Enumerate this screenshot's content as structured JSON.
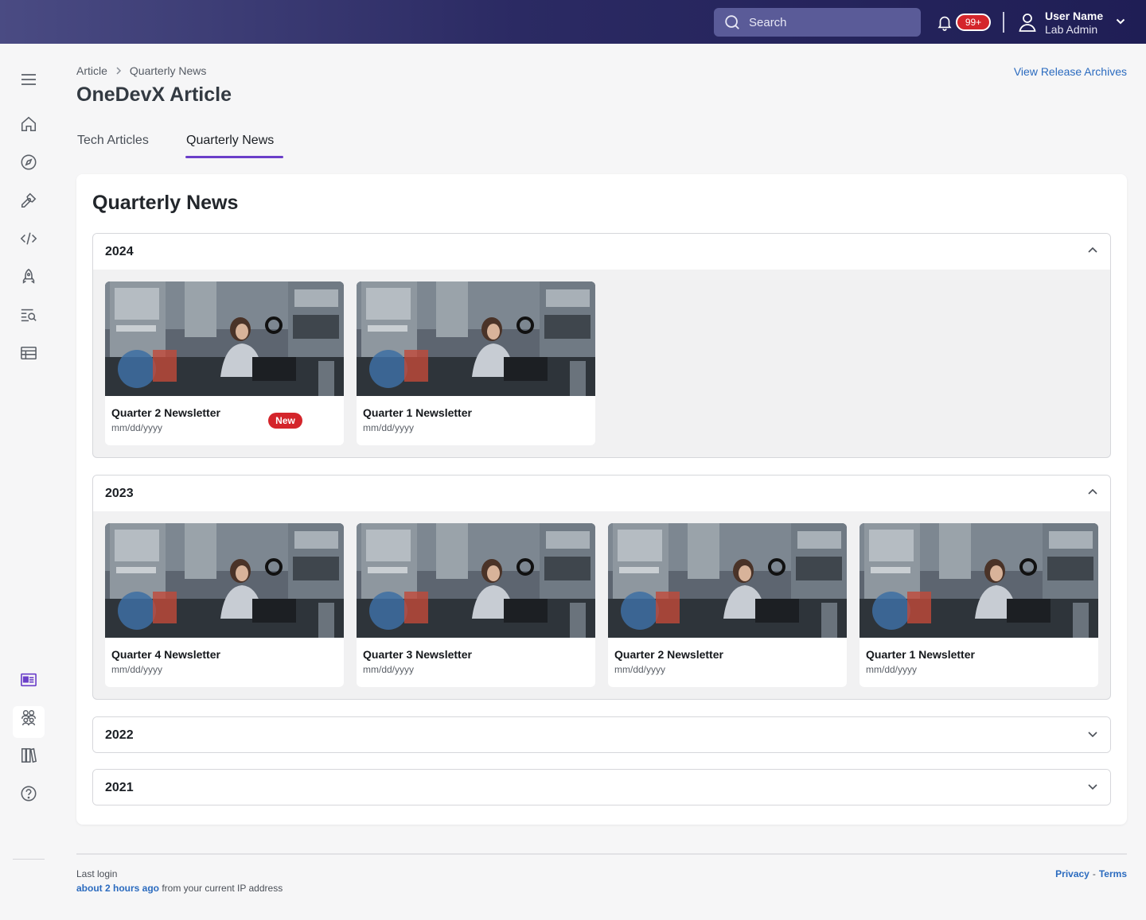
{
  "header": {
    "search_placeholder": "Search",
    "notification_count": "99+",
    "user_name": "User Name",
    "user_role": "Lab Admin"
  },
  "sidebar": {
    "icons": [
      "menu-icon",
      "home-icon",
      "compass-icon",
      "pen-icon",
      "code-icon",
      "rocket-icon",
      "search-list-icon",
      "table-icon",
      "newspaper-icon",
      "team-icon",
      "library-icon",
      "help-icon"
    ],
    "active": "newspaper-icon"
  },
  "breadcrumb": {
    "items": [
      "Article",
      "Quarterly News"
    ]
  },
  "page": {
    "title": "OneDevX Article",
    "archives_link": "View Release Archives",
    "tabs": [
      {
        "label": "Tech Articles"
      },
      {
        "label": "Quarterly News"
      }
    ],
    "active_tab": "Quarterly News"
  },
  "section": {
    "title": "Quarterly News",
    "years": [
      {
        "year": "2024",
        "expanded": true,
        "items": [
          {
            "title": "Quarter 2 Newsletter",
            "date": "mm/dd/yyyy",
            "badge": "New"
          },
          {
            "title": "Quarter 1 Newsletter",
            "date": "mm/dd/yyyy"
          }
        ]
      },
      {
        "year": "2023",
        "expanded": true,
        "items": [
          {
            "title": "Quarter 4 Newsletter",
            "date": "mm/dd/yyyy"
          },
          {
            "title": "Quarter 3 Newsletter",
            "date": "mm/dd/yyyy"
          },
          {
            "title": "Quarter 2 Newsletter",
            "date": "mm/dd/yyyy"
          },
          {
            "title": "Quarter 1 Newsletter",
            "date": "mm/dd/yyyy"
          }
        ]
      },
      {
        "year": "2022",
        "expanded": false
      },
      {
        "year": "2021",
        "expanded": false
      }
    ]
  },
  "footer": {
    "last_login_label": "Last login",
    "login_time": "about 2 hours ago",
    "login_suffix": " from your current IP address",
    "privacy": "Privacy",
    "separator": "-",
    "terms": "Terms"
  },
  "colors": {
    "accent": "#6b3fc9",
    "link": "#2b6bbf",
    "badge": "#d4252b",
    "header": "#2b2a63"
  }
}
